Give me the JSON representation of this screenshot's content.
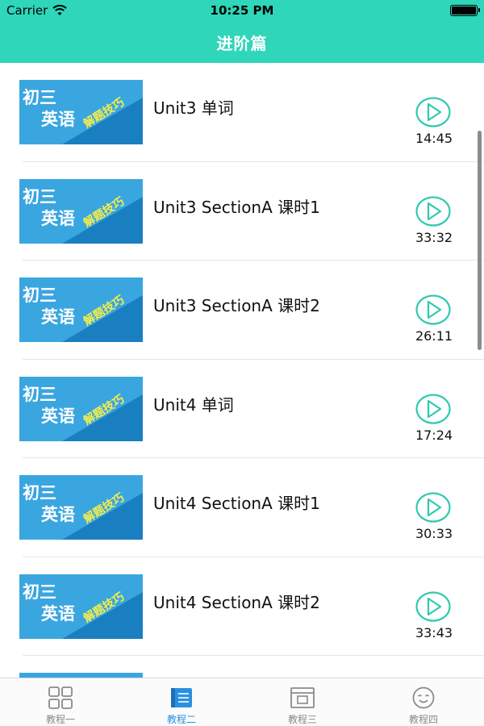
{
  "status_bar": {
    "carrier": "Carrier",
    "time": "10:25 PM"
  },
  "nav": {
    "title": "进阶篇"
  },
  "thumbnail": {
    "line1": "初三",
    "line2": "英语",
    "tag": "解题技巧"
  },
  "lessons": [
    {
      "title": "Unit3 单词",
      "duration": "14:45"
    },
    {
      "title": "Unit3 SectionA 课时1",
      "duration": "33:32"
    },
    {
      "title": "Unit3 SectionA 课时2",
      "duration": "26:11"
    },
    {
      "title": "Unit4 单词",
      "duration": "17:24"
    },
    {
      "title": "Unit4 SectionA 课时1",
      "duration": "30:33"
    },
    {
      "title": "Unit4 SectionA 课时2",
      "duration": "33:43"
    },
    {
      "title": "",
      "duration": ""
    }
  ],
  "tabs": [
    {
      "label": "教程一",
      "icon": "grid-icon"
    },
    {
      "label": "教程二",
      "icon": "book-icon"
    },
    {
      "label": "教程三",
      "icon": "window-icon"
    },
    {
      "label": "教程四",
      "icon": "smiley-icon"
    }
  ],
  "colors": {
    "header": "#2fd6b9",
    "accent": "#2fc9b0",
    "tab_active": "#2a90e0",
    "thumb_blue": "#3aa6e0",
    "thumb_tag": "#f7ee49"
  }
}
